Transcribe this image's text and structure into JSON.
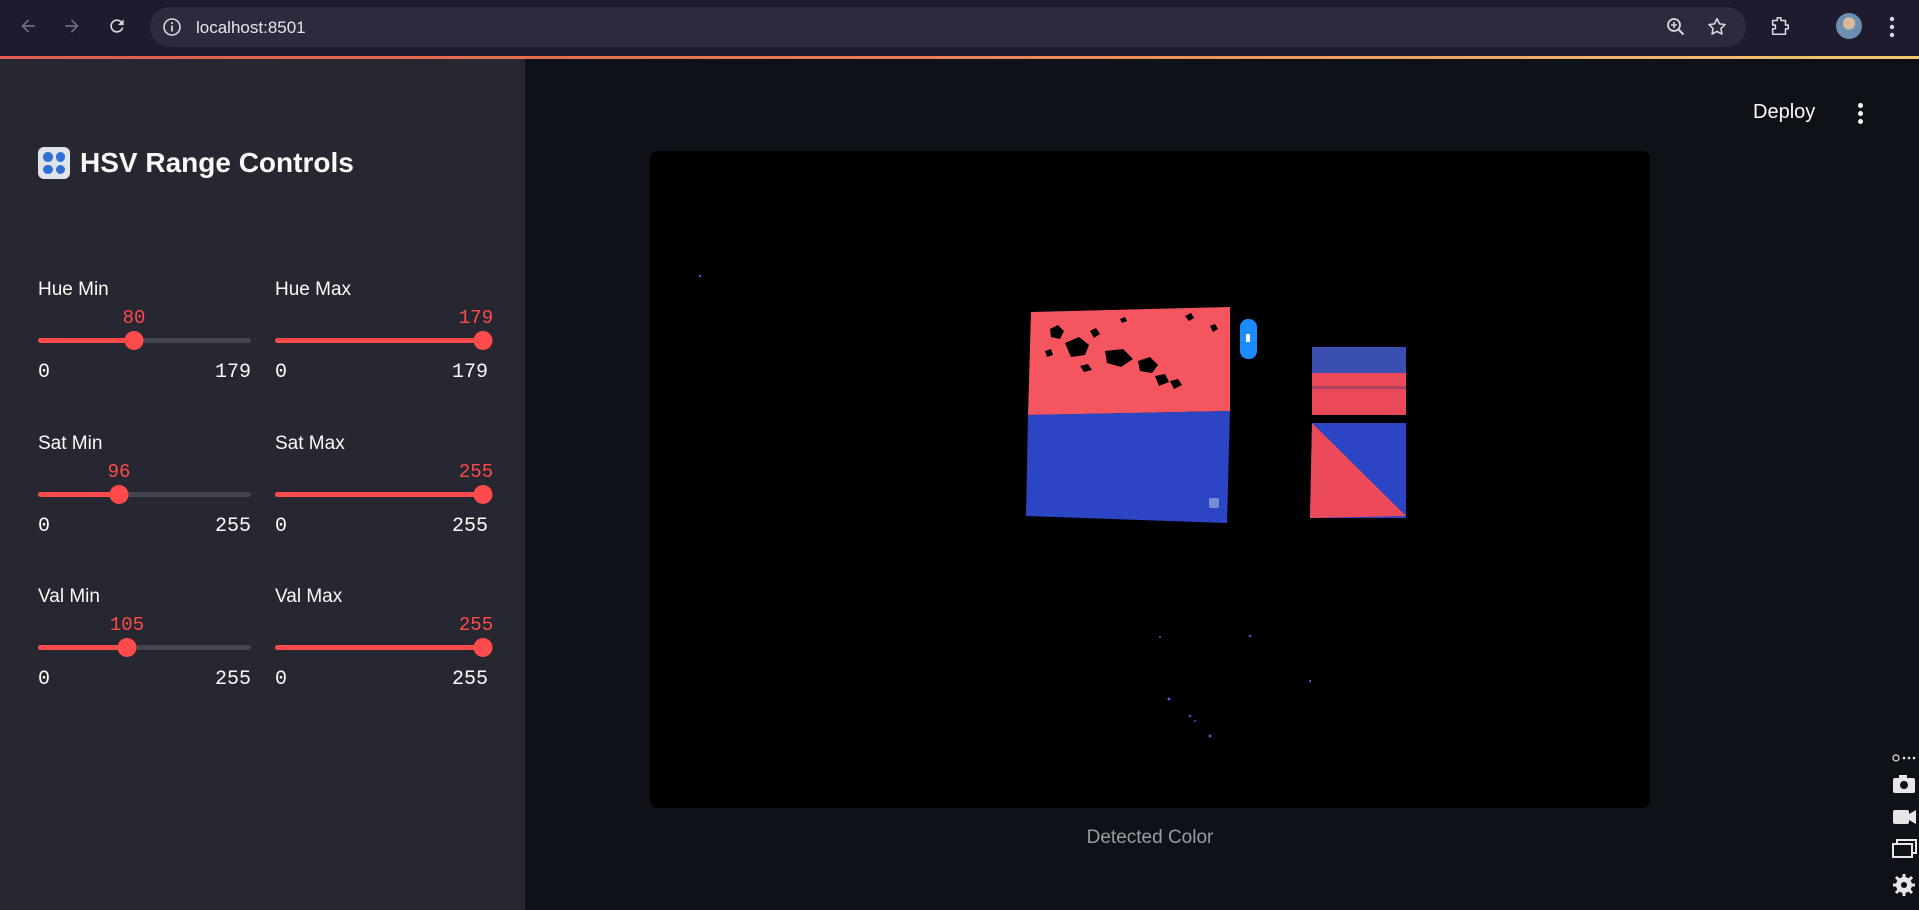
{
  "browser": {
    "url": "localhost:8501",
    "icons": [
      "back-icon",
      "forward-icon",
      "reload-icon",
      "site-info-icon",
      "zoom-icon",
      "star-icon",
      "extensions-icon",
      "profile-avatar",
      "more-vert-icon"
    ]
  },
  "sidebar": {
    "title": "HSV Range Controls",
    "title_icon": "control-knobs-icon",
    "sliders": [
      {
        "label": "Hue Min",
        "value": "80",
        "min": "0",
        "max": "179",
        "fraction": 0.447
      },
      {
        "label": "Hue Max",
        "value": "179",
        "min": "0",
        "max": "179",
        "fraction": 1.0
      },
      {
        "label": "Sat Min",
        "value": "96",
        "min": "0",
        "max": "255",
        "fraction": 0.376
      },
      {
        "label": "Sat Max",
        "value": "255",
        "min": "0",
        "max": "255",
        "fraction": 1.0
      },
      {
        "label": "Val Min",
        "value": "105",
        "min": "0",
        "max": "255",
        "fraction": 0.412
      },
      {
        "label": "Val Max",
        "value": "255",
        "min": "0",
        "max": "255",
        "fraction": 1.0
      }
    ]
  },
  "toolbar": {
    "deploy_label": "Deploy"
  },
  "main": {
    "image_caption": "Detected Color"
  },
  "colors": {
    "accent": "#ff4b4b",
    "sidebar_bg": "#262730",
    "app_bg": "#0e1117",
    "mask_red": "#f4555f",
    "mask_blue": "#2b45c4"
  }
}
